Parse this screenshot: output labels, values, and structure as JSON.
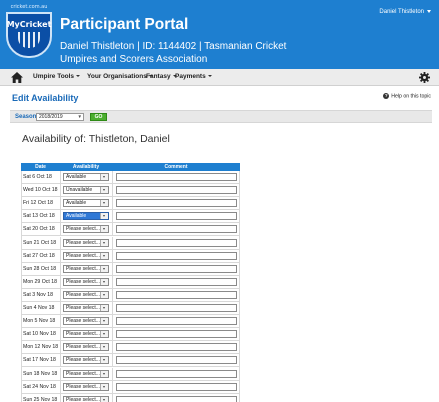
{
  "header": {
    "logo_small_text": "cricket.com.au",
    "logo_text": "MyCricket",
    "title": "Participant Portal",
    "user_name": "Daniel Thistleton",
    "participant_info": "Daniel Thistleton | ID: 1144402 | Tasmanian Cricket Umpires and Scorers Association"
  },
  "nav": {
    "home_icon": "home-icon",
    "items": [
      "Umpire Tools",
      "Your Organisations",
      "Fantasy",
      "Payments"
    ],
    "settings_icon": "gear-icon"
  },
  "page": {
    "title": "Edit Availability",
    "help_text": "Help on this topic",
    "season_label": "Season",
    "season_value": "2018/2019",
    "go_label": "GO",
    "availability_of": "Availability of: Thistleton, Daniel"
  },
  "table": {
    "headers": [
      "Date",
      "Availability",
      "Comment"
    ],
    "rows": [
      {
        "date": "Sat 6 Oct 18",
        "availability": "Available",
        "comment": ""
      },
      {
        "date": "Wed 10 Oct 18",
        "availability": "Unavailable",
        "comment": ""
      },
      {
        "date": "Fri 12 Oct 18",
        "availability": "Available",
        "comment": ""
      },
      {
        "date": "Sat 13 Oct 18",
        "availability": "Available",
        "comment": "",
        "selected": true
      },
      {
        "date": "Sat 20 Oct 18",
        "availability": "Please select...",
        "comment": ""
      },
      {
        "date": "Sun 21 Oct 18",
        "availability": "Please select...",
        "comment": ""
      },
      {
        "date": "Sat 27 Oct 18",
        "availability": "Please select...",
        "comment": ""
      },
      {
        "date": "Sun 28 Oct 18",
        "availability": "Please select...",
        "comment": ""
      },
      {
        "date": "Mon 29 Oct 18",
        "availability": "Please select...",
        "comment": ""
      },
      {
        "date": "Sat 3 Nov 18",
        "availability": "Please select...",
        "comment": ""
      },
      {
        "date": "Sun 4 Nov 18",
        "availability": "Please select...",
        "comment": ""
      },
      {
        "date": "Mon 5 Nov 18",
        "availability": "Please select...",
        "comment": ""
      },
      {
        "date": "Sat 10 Nov 18",
        "availability": "Please select...",
        "comment": ""
      },
      {
        "date": "Mon 12 Nov 18",
        "availability": "Please select...",
        "comment": ""
      },
      {
        "date": "Sat 17 Nov 18",
        "availability": "Please select...",
        "comment": ""
      },
      {
        "date": "Sun 18 Nov 18",
        "availability": "Please select...",
        "comment": ""
      },
      {
        "date": "Sat 24 Nov 18",
        "availability": "Please select...",
        "comment": ""
      },
      {
        "date": "Sun 25 Nov 18",
        "availability": "Please select...",
        "comment": ""
      }
    ]
  },
  "colors": {
    "header_blue": "#1e7fd0",
    "title_blue": "#1a6ab8",
    "go_green": "#4caf2f",
    "selected_blue": "#2f78d6"
  }
}
